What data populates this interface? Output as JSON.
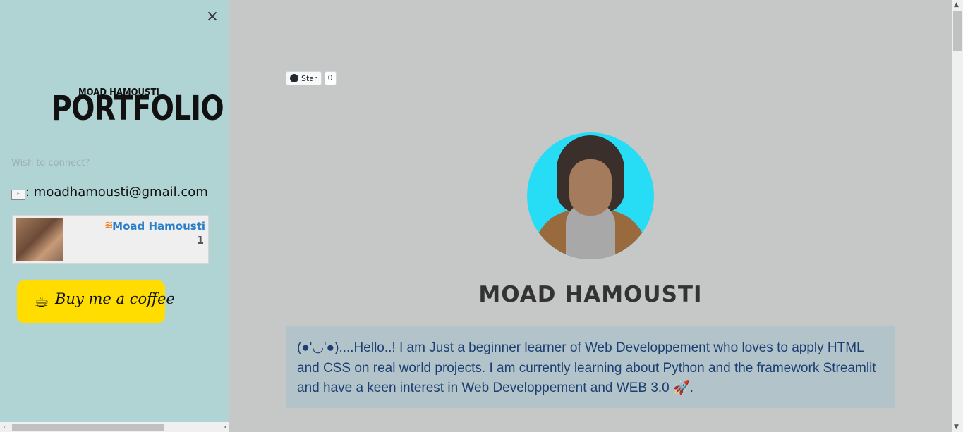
{
  "sidebar": {
    "close_icon": "×",
    "logo": {
      "top_text": "MOAD HAMOUSTI",
      "main_text": "PORTFOLIO"
    },
    "connect_label": "Wish to connect?",
    "email_icon": "E",
    "email_text": ": moadhamousti@gmail.com",
    "stackoverflow": {
      "name": "Moad Hamousti",
      "reputation": "1",
      "icon": "≋"
    },
    "coffee": {
      "label": "Buy me a coffee",
      "icon": "☕"
    }
  },
  "github_badge": {
    "label": "Star",
    "count": "0"
  },
  "profile": {
    "name": "MOAD HAMOUSTI"
  },
  "bio": {
    "text": "(●'◡'●)....Hello..! I am Just a beginner learner of Web Developpement who loves to apply HTML and CSS on real world projects. I am currently learning about Python and the framework Streamlit and have a keen interest in Web Developpement and WEB 3.0 🚀."
  },
  "colors": {
    "sidebar_bg": "#b0d3d4",
    "main_bg": "#c6c8c7",
    "coffee_yellow": "#ffdd00",
    "bio_text": "#1b3f72",
    "so_link": "#2a7fc9"
  },
  "scrollbars": {
    "h_left_arrow": "‹",
    "h_right_arrow": "›",
    "v_up_arrow": "▲",
    "v_down_arrow": "▼"
  }
}
